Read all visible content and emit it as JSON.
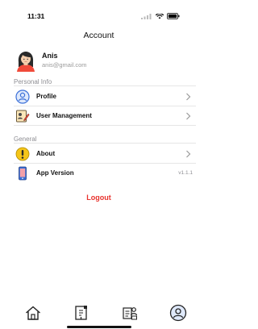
{
  "status_bar": {
    "time": "11:31",
    "icons": [
      "cellular-icon",
      "wifi-icon",
      "battery-icon"
    ]
  },
  "header": {
    "title": "Account"
  },
  "profile": {
    "name": "Anis",
    "email": "anis@gmail.com",
    "avatar_icon": "avatar-icon"
  },
  "sections": {
    "personal_info": {
      "label": "Personal Info",
      "items": [
        {
          "label": "Profile",
          "icon": "user-circle-icon"
        },
        {
          "label": "User Management",
          "icon": "user-edit-icon"
        }
      ]
    },
    "general": {
      "label": "General",
      "items": [
        {
          "label": "About",
          "icon": "info-icon"
        },
        {
          "label": "App Version",
          "icon": "phone-icon",
          "value": "v1.1.1"
        }
      ]
    }
  },
  "logout": {
    "label": "Logout"
  },
  "tab_bar": {
    "tabs": [
      {
        "icon": "home-icon",
        "active": false
      },
      {
        "icon": "document-icon",
        "active": false
      },
      {
        "icon": "management-icon",
        "active": false
      },
      {
        "icon": "account-icon",
        "active": true
      }
    ]
  },
  "colors": {
    "accent_red": "#e8322d",
    "icon_blue": "#3a6fd8",
    "icon_yellow": "#f5c518",
    "text_secondary": "#8e8e93"
  }
}
